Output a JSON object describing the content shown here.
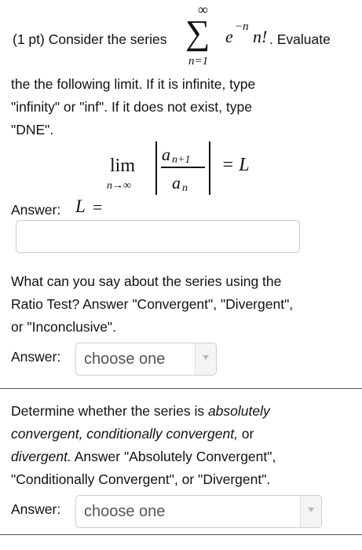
{
  "question1": {
    "pt": "(1 pt) Consider the series",
    "sum_top": "∞",
    "sum_symbol": "∑",
    "sum_bottom": "n=1",
    "term_base": "e",
    "term_exp": "−n",
    "term_rest": "n!",
    "evaluate": ". Evaluate",
    "line2": "the the following limit. If it is infinite, type",
    "line3": "\"infinity\" or \"inf\". If it does not exist, type",
    "line4": "\"DNE\"."
  },
  "limit_expr": {
    "lim": "lim",
    "sub": "n→∞",
    "num_a": "a",
    "num_sub": "n+1",
    "den_a": "a",
    "den_sub": "n",
    "equals": "= L"
  },
  "answer1": {
    "label": "Answer:",
    "L": "L",
    "eq": "=",
    "value": ""
  },
  "question2": {
    "line1": "What can you say about the series using the",
    "line2": "Ratio Test? Answer \"Convergent\", \"Divergent\",",
    "line3": "or \"Inconclusive\".",
    "answer_label": "Answer:",
    "select_value": "choose one"
  },
  "question3": {
    "line1_a": "Determine whether the series is ",
    "line1_b": "absolutely",
    "line2_a": "convergent, conditionally convergent,",
    "line2_b": " or",
    "line3_a": "divergent.",
    "line3_b": " Answer \"Absolutely Convergent\",",
    "line4": "\"Conditionally Convergent\", or \"Divergent\".",
    "answer_label": "Answer:",
    "select_value": "choose one"
  }
}
